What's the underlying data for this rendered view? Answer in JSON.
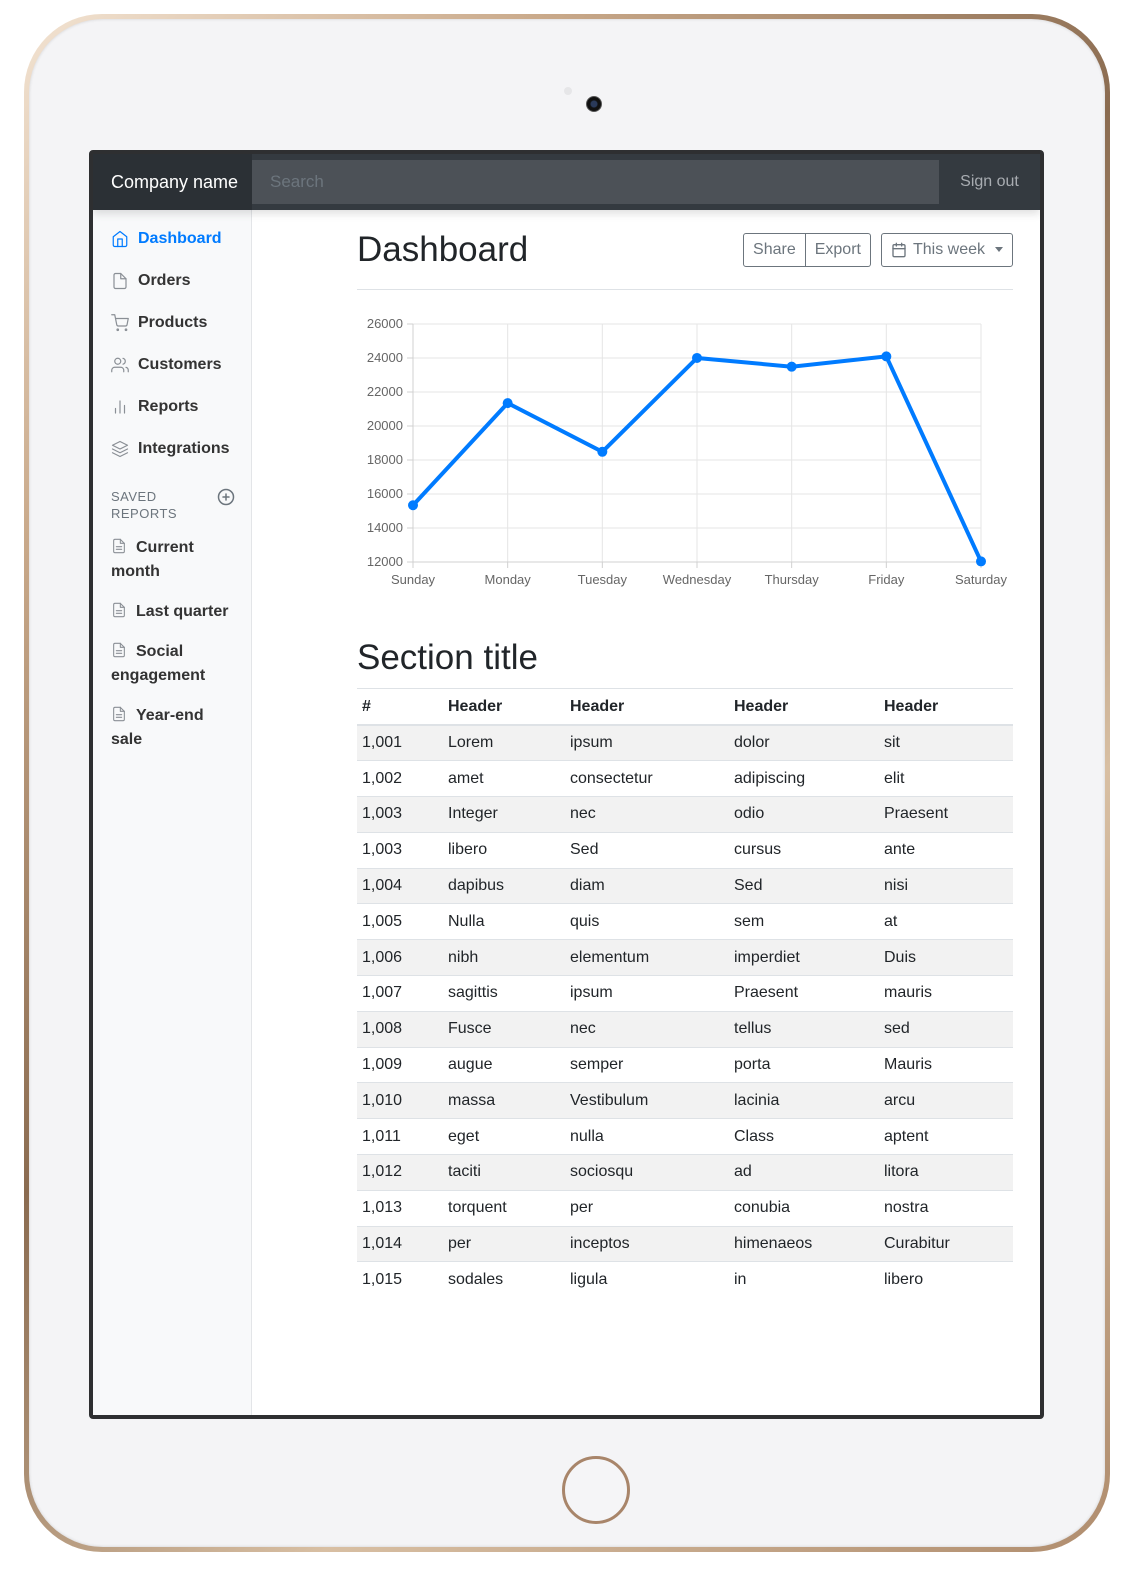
{
  "navbar": {
    "brand": "Company name",
    "search_placeholder": "Search",
    "signout": "Sign out"
  },
  "sidebar": {
    "items": [
      {
        "label": "Dashboard",
        "icon": "home-icon",
        "active": true
      },
      {
        "label": "Orders",
        "icon": "file-icon",
        "active": false
      },
      {
        "label": "Products",
        "icon": "shopping-cart-icon",
        "active": false
      },
      {
        "label": "Customers",
        "icon": "users-icon",
        "active": false
      },
      {
        "label": "Reports",
        "icon": "bar-chart-icon",
        "active": false
      },
      {
        "label": "Integrations",
        "icon": "layers-icon",
        "active": false
      }
    ],
    "saved_heading": "SAVED REPORTS",
    "reports": [
      {
        "label": "Current month",
        "icon": "file-text-icon"
      },
      {
        "label": "Last quarter",
        "icon": "file-text-icon"
      },
      {
        "label": "Social engagement",
        "icon": "file-text-icon"
      },
      {
        "label": "Year-end sale",
        "icon": "file-text-icon"
      }
    ]
  },
  "main": {
    "title": "Dashboard",
    "share_label": "Share",
    "export_label": "Export",
    "range_label": "This week",
    "section_title": "Section title"
  },
  "colors": {
    "accent": "#007bff",
    "navbar": "#343a40"
  },
  "chart_data": {
    "type": "line",
    "categories": [
      "Sunday",
      "Monday",
      "Tuesday",
      "Wednesday",
      "Thursday",
      "Friday",
      "Saturday"
    ],
    "series": [
      {
        "values": [
          15339,
          21345,
          18483,
          24003,
          23489,
          24092,
          12034
        ]
      }
    ],
    "ylim": [
      12000,
      26000
    ],
    "yticks": [
      12000,
      14000,
      16000,
      18000,
      20000,
      22000,
      24000,
      26000
    ],
    "grid": true,
    "color": "#007bff"
  },
  "table": {
    "headers": [
      "#",
      "Header",
      "Header",
      "Header",
      "Header"
    ],
    "rows": [
      [
        "1,001",
        "Lorem",
        "ipsum",
        "dolor",
        "sit"
      ],
      [
        "1,002",
        "amet",
        "consectetur",
        "adipiscing",
        "elit"
      ],
      [
        "1,003",
        "Integer",
        "nec",
        "odio",
        "Praesent"
      ],
      [
        "1,003",
        "libero",
        "Sed",
        "cursus",
        "ante"
      ],
      [
        "1,004",
        "dapibus",
        "diam",
        "Sed",
        "nisi"
      ],
      [
        "1,005",
        "Nulla",
        "quis",
        "sem",
        "at"
      ],
      [
        "1,006",
        "nibh",
        "elementum",
        "imperdiet",
        "Duis"
      ],
      [
        "1,007",
        "sagittis",
        "ipsum",
        "Praesent",
        "mauris"
      ],
      [
        "1,008",
        "Fusce",
        "nec",
        "tellus",
        "sed"
      ],
      [
        "1,009",
        "augue",
        "semper",
        "porta",
        "Mauris"
      ],
      [
        "1,010",
        "massa",
        "Vestibulum",
        "lacinia",
        "arcu"
      ],
      [
        "1,011",
        "eget",
        "nulla",
        "Class",
        "aptent"
      ],
      [
        "1,012",
        "taciti",
        "sociosqu",
        "ad",
        "litora"
      ],
      [
        "1,013",
        "torquent",
        "per",
        "conubia",
        "nostra"
      ],
      [
        "1,014",
        "per",
        "inceptos",
        "himenaeos",
        "Curabitur"
      ],
      [
        "1,015",
        "sodales",
        "ligula",
        "in",
        "libero"
      ]
    ]
  }
}
